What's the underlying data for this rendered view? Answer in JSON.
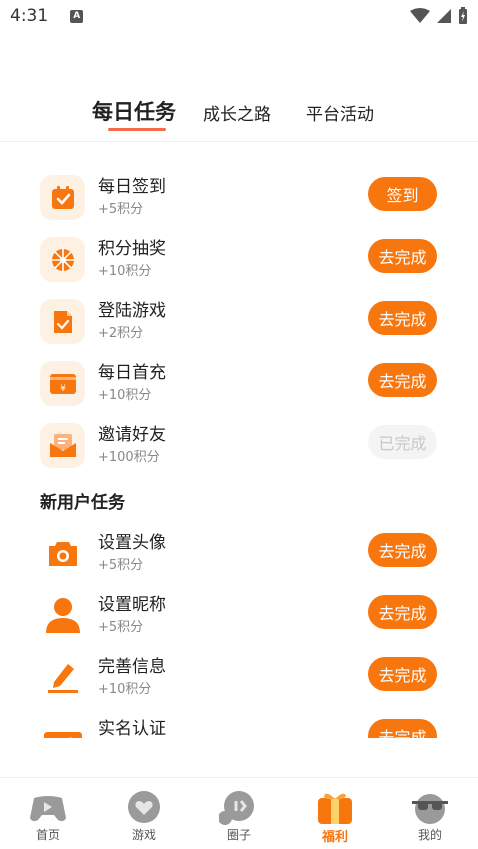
{
  "status_bar": {
    "time": "4:31",
    "notification_badge": "A"
  },
  "tabs": [
    {
      "label": "每日任务",
      "active": true
    },
    {
      "label": "成长之路",
      "active": false
    },
    {
      "label": "平台活动",
      "active": false
    }
  ],
  "daily_tasks": [
    {
      "title": "每日签到",
      "points": "+5积分",
      "button": "签到",
      "icon": "calendar-check-icon",
      "done": false
    },
    {
      "title": "积分抽奖",
      "points": "+10积分",
      "button": "去完成",
      "icon": "lottery-wheel-icon",
      "done": false
    },
    {
      "title": "登陆游戏",
      "points": "+2积分",
      "button": "去完成",
      "icon": "document-check-icon",
      "done": false
    },
    {
      "title": "每日首充",
      "points": "+10积分",
      "button": "去完成",
      "icon": "wallet-yuan-icon",
      "done": false
    },
    {
      "title": "邀请好友",
      "points": "+100积分",
      "button": "已完成",
      "icon": "invite-envelope-icon",
      "done": true
    }
  ],
  "new_user_section": {
    "title": "新用户任务",
    "tasks": [
      {
        "title": "设置头像",
        "points": "+5积分",
        "button": "去完成",
        "icon": "camera-icon"
      },
      {
        "title": "设置昵称",
        "points": "+5积分",
        "button": "去完成",
        "icon": "user-icon"
      },
      {
        "title": "完善信息",
        "points": "+10积分",
        "button": "去完成",
        "icon": "pencil-icon"
      },
      {
        "title": "实名认证",
        "points": "",
        "button": "去完成",
        "icon": "id-card-icon"
      }
    ]
  },
  "bottom_nav": [
    {
      "label": "首页",
      "icon": "gamepad-icon",
      "active": false
    },
    {
      "label": "游戏",
      "icon": "heart-bubble-icon",
      "active": false
    },
    {
      "label": "圈子",
      "icon": "chat-bubble-icon",
      "active": false
    },
    {
      "label": "福利",
      "icon": "gift-icon",
      "active": true
    },
    {
      "label": "我的",
      "icon": "sunglasses-face-icon",
      "active": false
    }
  ],
  "colors": {
    "accent": "#f8760e",
    "tab_underline": "#f26b4a",
    "icon_bg": "#fdf1e4",
    "done_bg": "#f4f4f4"
  }
}
